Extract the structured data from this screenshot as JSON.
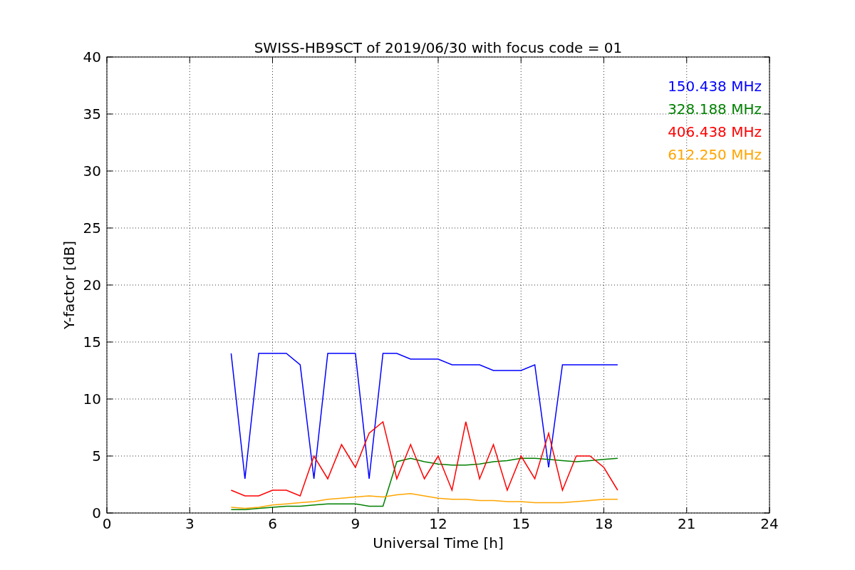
{
  "chart_data": {
    "type": "line",
    "title": "SWISS-HB9SCT of 2019/06/30 with focus code = 01",
    "xlabel": "Universal Time [h]",
    "ylabel": "Y-factor [dB]",
    "x": [
      4.5,
      5,
      5.5,
      6,
      6.5,
      7,
      7.5,
      8,
      8.5,
      9,
      9.5,
      10,
      10.5,
      11,
      11.5,
      12,
      12.5,
      13,
      13.5,
      14,
      14.5,
      15,
      15.5,
      16,
      16.5,
      17,
      17.5,
      18,
      18.5
    ],
    "series": [
      {
        "name": "150.438 MHz",
        "color": "#0000ff",
        "values": [
          14,
          3,
          14,
          14,
          14,
          13,
          3,
          14,
          14,
          14,
          3,
          14,
          14,
          13.5,
          13.5,
          13.5,
          13,
          13,
          13,
          12.5,
          12.5,
          12.5,
          13,
          4,
          13,
          13,
          13,
          13,
          13
        ]
      },
      {
        "name": "328.188 MHz",
        "color": "#008000",
        "values": [
          0.3,
          0.3,
          0.4,
          0.5,
          0.6,
          0.6,
          0.7,
          0.8,
          0.8,
          0.8,
          0.6,
          0.6,
          4.5,
          4.8,
          4.5,
          4.3,
          4.2,
          4.2,
          4.3,
          4.5,
          4.6,
          4.8,
          4.8,
          4.7,
          4.6,
          4.5,
          4.6,
          4.7,
          4.8
        ]
      },
      {
        "name": "406.438 MHz",
        "color": "#ff0000",
        "values": [
          2,
          1.5,
          1.5,
          2,
          2,
          1.5,
          5,
          3,
          6,
          4,
          7,
          8,
          3,
          6,
          3,
          5,
          2,
          8,
          3,
          6,
          2,
          5,
          3,
          7,
          2,
          5,
          5,
          4,
          2
        ]
      },
      {
        "name": "612.250 MHz",
        "color": "#ffa500",
        "values": [
          0.5,
          0.4,
          0.5,
          0.7,
          0.8,
          0.9,
          1,
          1.2,
          1.3,
          1.4,
          1.5,
          1.4,
          1.6,
          1.7,
          1.5,
          1.3,
          1.2,
          1.2,
          1.1,
          1.1,
          1,
          1,
          0.9,
          0.9,
          0.9,
          1,
          1.1,
          1.2,
          1.2
        ]
      }
    ],
    "xlim": [
      0,
      24
    ],
    "ylim": [
      0,
      40
    ],
    "xticks": [
      0,
      3,
      6,
      9,
      12,
      15,
      18,
      21,
      24
    ],
    "yticks": [
      0,
      5,
      10,
      15,
      20,
      25,
      30,
      35,
      40
    ],
    "grid": true
  }
}
